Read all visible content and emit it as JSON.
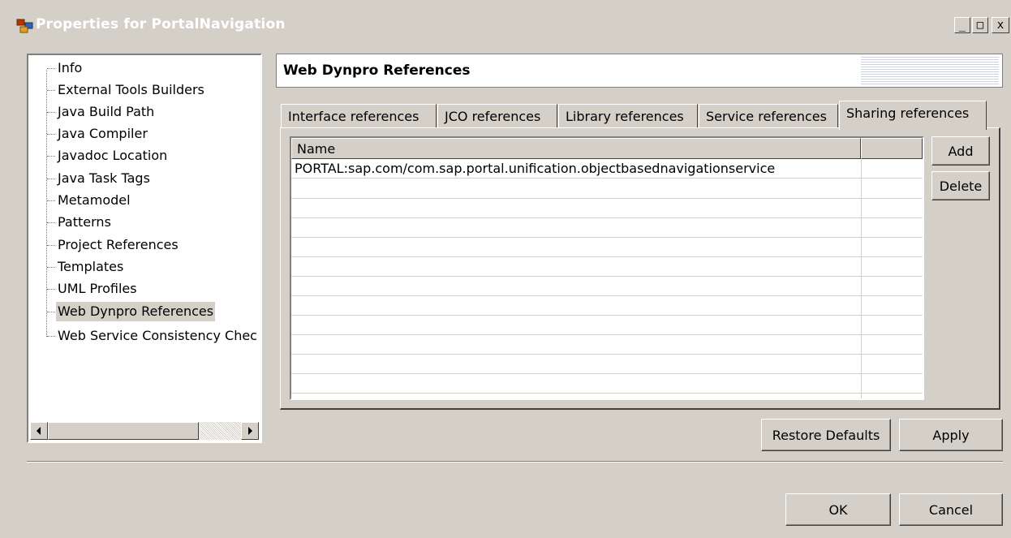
{
  "window": {
    "title": "Properties for PortalNavigation",
    "minimize_label": "_",
    "maximize_label": "□",
    "close_label": "x"
  },
  "tree": {
    "items": [
      {
        "label": "Info"
      },
      {
        "label": "External Tools Builders"
      },
      {
        "label": "Java Build Path"
      },
      {
        "label": "Java Compiler"
      },
      {
        "label": "Javadoc Location"
      },
      {
        "label": "Java Task Tags"
      },
      {
        "label": "Metamodel"
      },
      {
        "label": "Patterns"
      },
      {
        "label": "Project References"
      },
      {
        "label": "Templates"
      },
      {
        "label": "UML Profiles"
      },
      {
        "label": "Web Dynpro References"
      },
      {
        "label": "Web Service Consistency Chec"
      }
    ],
    "selected": "Web Dynpro References"
  },
  "page": {
    "heading": "Web Dynpro References"
  },
  "tabs": [
    {
      "label": "Interface references"
    },
    {
      "label": "JCO references"
    },
    {
      "label": "Library references"
    },
    {
      "label": "Service references"
    },
    {
      "label": "Sharing references"
    }
  ],
  "active_tab": "Sharing references",
  "table": {
    "columns": [
      "Name",
      ""
    ],
    "rows": [
      [
        "PORTAL:sap.com/com.sap.portal.unification.objectbasednavigationservice",
        ""
      ]
    ]
  },
  "side_buttons": {
    "add": "Add",
    "delete": "Delete"
  },
  "footer": {
    "restore_defaults": "Restore Defaults",
    "apply": "Apply",
    "ok": "OK",
    "cancel": "Cancel"
  },
  "colors": {
    "dialog_bg": "#d4d0c8",
    "selection_bg": "#d4d0c8"
  }
}
